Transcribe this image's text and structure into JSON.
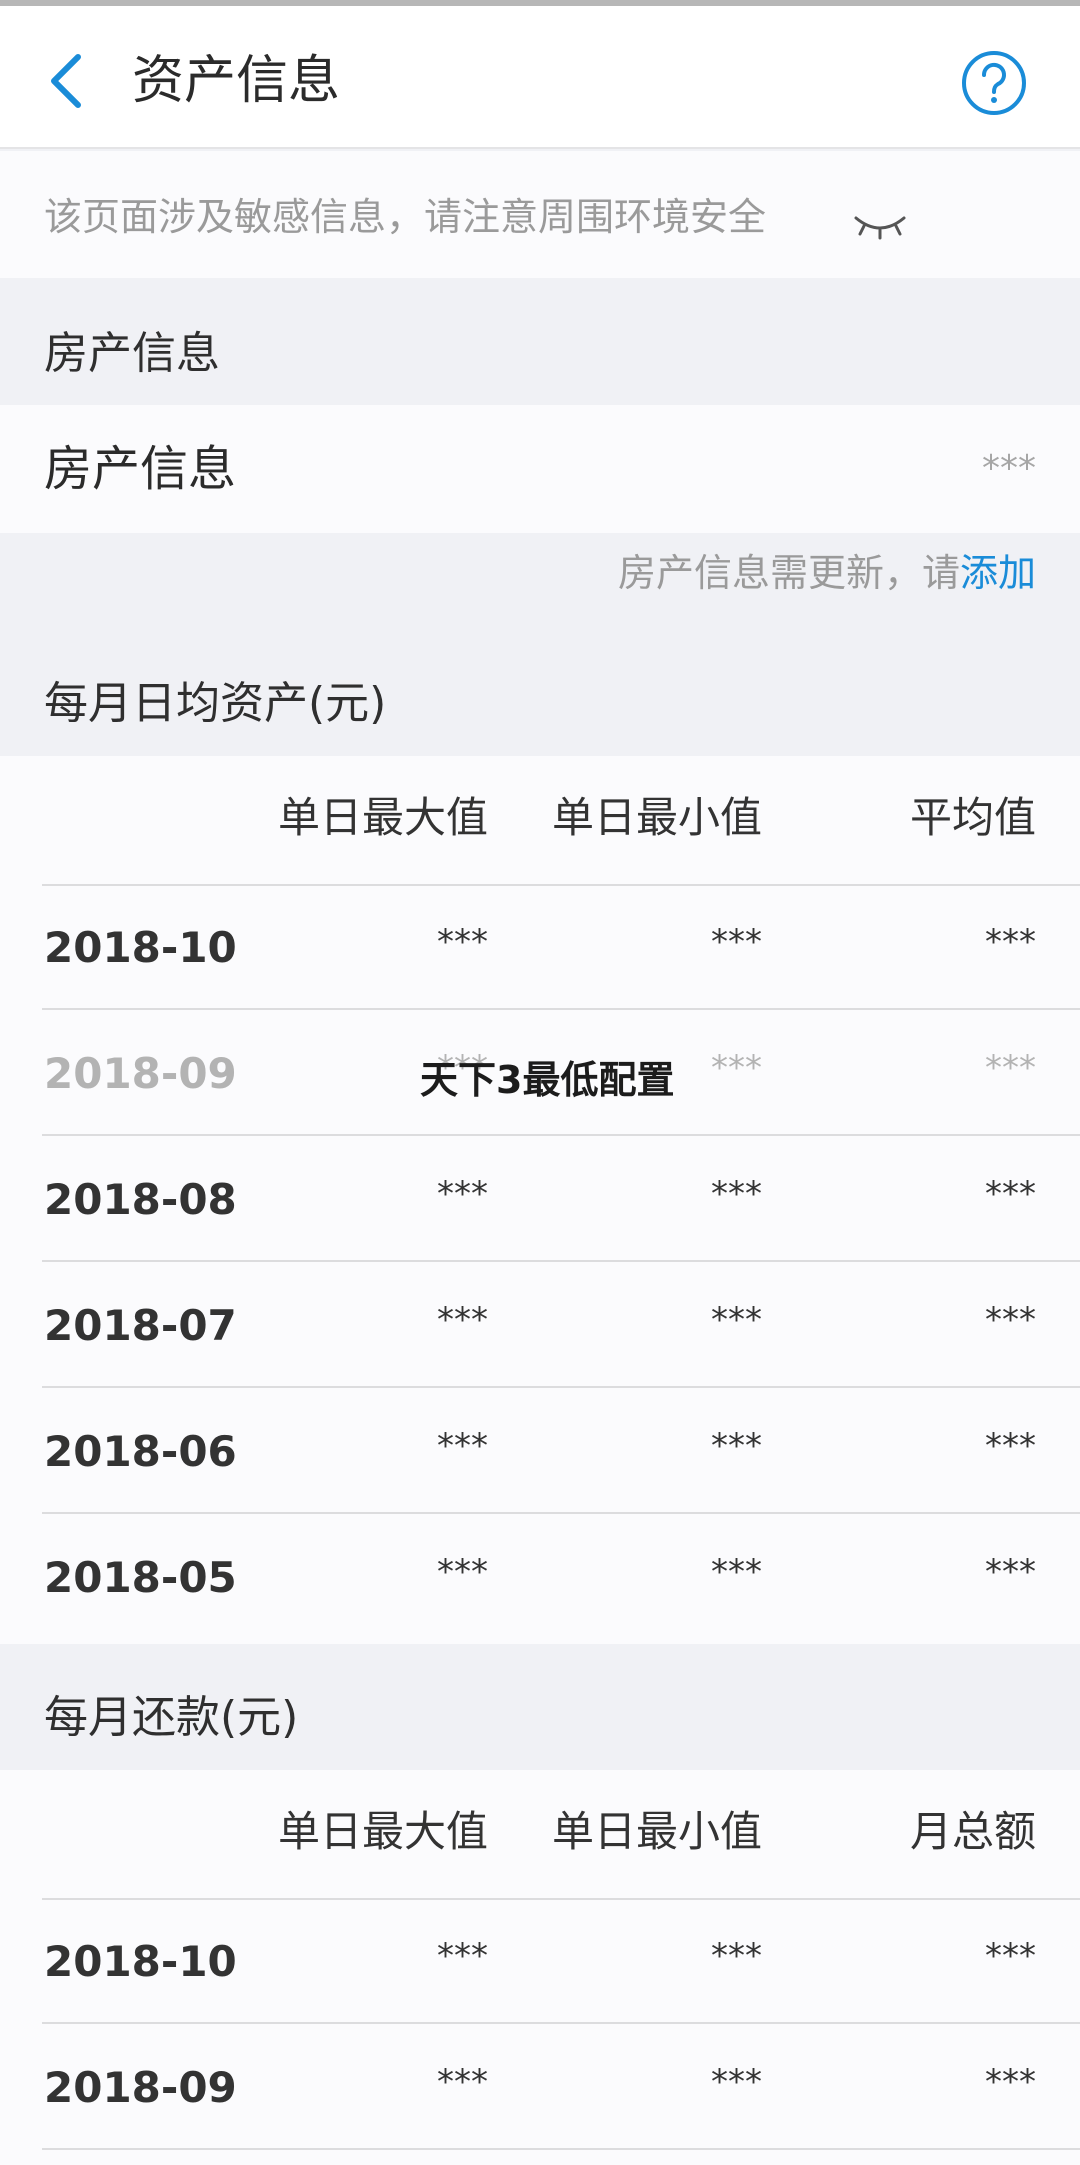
{
  "header": {
    "title": "资产信息"
  },
  "notice": {
    "text": "该页面涉及敏感信息，请注意周围环境安全"
  },
  "property": {
    "section_title": "房产信息",
    "row_label": "房产信息",
    "row_value": "***",
    "hint_prefix": "房产信息需更新，请",
    "hint_link": "添加"
  },
  "assets": {
    "section_title": "每月日均资产(元)",
    "columns": [
      "单日最大值",
      "单日最小值",
      "平均值"
    ],
    "rows": [
      {
        "date": "2018-10",
        "max": "***",
        "min": "***",
        "avg": "***"
      },
      {
        "date": "2018-09",
        "max": "***",
        "min": "***",
        "avg": "***"
      },
      {
        "date": "2018-08",
        "max": "***",
        "min": "***",
        "avg": "***"
      },
      {
        "date": "2018-07",
        "max": "***",
        "min": "***",
        "avg": "***"
      },
      {
        "date": "2018-06",
        "max": "***",
        "min": "***",
        "avg": "***"
      },
      {
        "date": "2018-05",
        "max": "***",
        "min": "***",
        "avg": "***"
      }
    ]
  },
  "repayment": {
    "section_title": "每月还款(元)",
    "columns": [
      "单日最大值",
      "单日最小值",
      "月总额"
    ],
    "rows": [
      {
        "date": "2018-10",
        "max": "***",
        "min": "***",
        "total": "***"
      },
      {
        "date": "2018-09",
        "max": "***",
        "min": "***",
        "total": "***"
      }
    ]
  },
  "overlay": {
    "watermark": "天下3最低配置"
  },
  "colors": {
    "accent": "#1a8cd8",
    "background": "#f0f1f5",
    "card": "#fbfbfd"
  },
  "icons": {
    "back": "chevron-left-icon",
    "help": "question-circle-icon",
    "eye": "eye-closed-icon"
  }
}
